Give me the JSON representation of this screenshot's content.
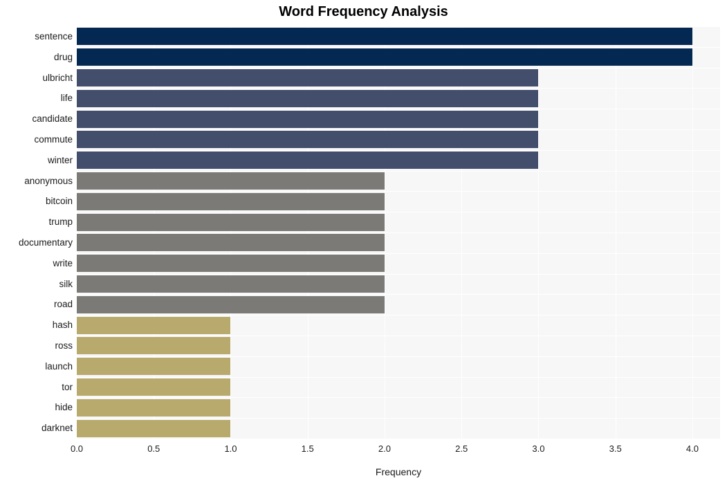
{
  "chart_data": {
    "type": "bar",
    "orientation": "horizontal",
    "title": "Word Frequency Analysis",
    "xlabel": "Frequency",
    "ylabel": "",
    "xlim": [
      0,
      4.18
    ],
    "xticks": [
      0.0,
      0.5,
      1.0,
      1.5,
      2.0,
      2.5,
      3.0,
      3.5,
      4.0
    ],
    "xtick_labels": [
      "0.0",
      "0.5",
      "1.0",
      "1.5",
      "2.0",
      "2.5",
      "3.0",
      "3.5",
      "4.0"
    ],
    "grid": true,
    "legend": null,
    "categories": [
      "sentence",
      "drug",
      "ulbricht",
      "life",
      "candidate",
      "commute",
      "winter",
      "anonymous",
      "bitcoin",
      "trump",
      "documentary",
      "write",
      "silk",
      "road",
      "hash",
      "ross",
      "launch",
      "tor",
      "hide",
      "darknet"
    ],
    "values": [
      4,
      4,
      3,
      3,
      3,
      3,
      3,
      2,
      2,
      2,
      2,
      2,
      2,
      2,
      1,
      1,
      1,
      1,
      1,
      1
    ],
    "bar_colors": [
      "#032952",
      "#032952",
      "#434e6c",
      "#434e6c",
      "#434e6c",
      "#434e6c",
      "#434e6c",
      "#7b7a76",
      "#7b7a76",
      "#7b7a76",
      "#7b7a76",
      "#7b7a76",
      "#7b7a76",
      "#7b7a76",
      "#b8a96d",
      "#b8a96d",
      "#b8a96d",
      "#b8a96d",
      "#b8a96d",
      "#b8a96d"
    ],
    "plot_background": "#f7f7f7",
    "gridline_color": "#ffffff",
    "figure_background": "#ffffff"
  }
}
